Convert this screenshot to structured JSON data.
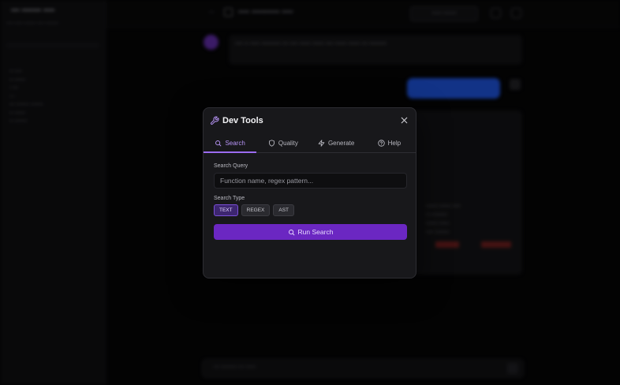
{
  "modal": {
    "title": "Dev Tools",
    "tabs": [
      {
        "label": "Search",
        "icon": "search-icon",
        "active": true
      },
      {
        "label": "Quality",
        "icon": "shield-icon",
        "active": false
      },
      {
        "label": "Generate",
        "icon": "lightning-icon",
        "active": false
      },
      {
        "label": "Help",
        "icon": "help-circle-icon",
        "active": false
      }
    ],
    "search_query_label": "Search Query",
    "search_query_placeholder": "Function name, regex pattern...",
    "search_query_value": "",
    "search_type_label": "Search Type",
    "search_types": [
      {
        "label": "TEXT",
        "selected": true
      },
      {
        "label": "REGEX",
        "selected": false
      },
      {
        "label": "AST",
        "selected": false
      }
    ],
    "run_label": "Run Search"
  },
  "colors": {
    "accent": "#7a3fd0",
    "accent_text": "#b794f6",
    "modal_bg": "#18181b",
    "page_bg": "#050506"
  }
}
